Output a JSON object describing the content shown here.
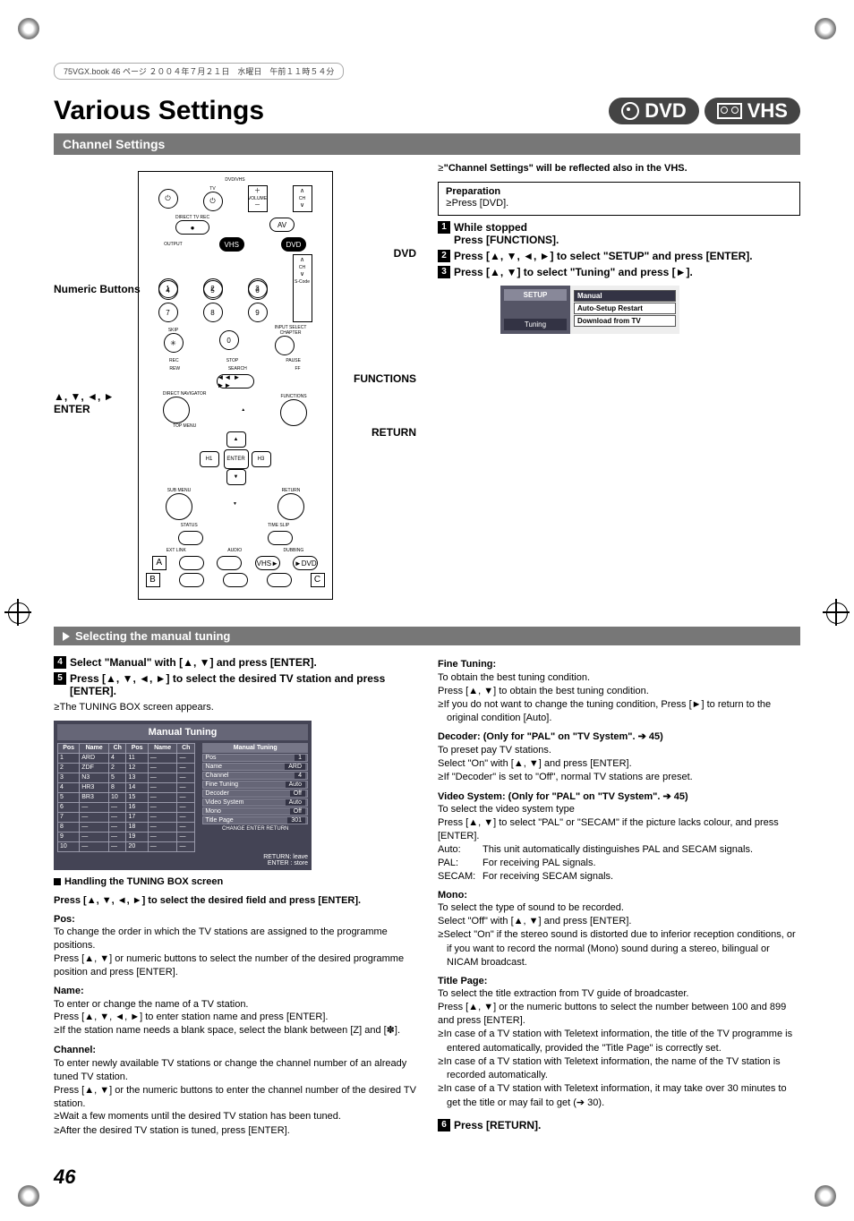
{
  "meta_header": "75VGX.book  46 ページ  ２００４年７月２１日　水曜日　午前１１時５４分",
  "title": "Various Settings",
  "badge_dvd": "DVD",
  "badge_vhs": "VHS",
  "section_channel_settings": "Channel Settings",
  "remote_callout": {
    "dvd": "DVD",
    "numeric": "Numeric Buttons",
    "functions": "FUNCTIONS",
    "arrows_enter": "▲, ▼, ◄, ►\nENTER",
    "return": "RETURN"
  },
  "remote_letters": {
    "a": "A",
    "b": "B",
    "c": "C"
  },
  "remote_btn_labels": {
    "dvd_vhs": "DVD/VHS",
    "tv": "TV",
    "volume": "VOLUME",
    "ch_label": "CH",
    "directrec": "DIRECT TV REC",
    "av": "AV",
    "output": "OUTPUT",
    "vhs": "VHS",
    "dvd": "DVD",
    "ch": "CH",
    "scode": "S-Code",
    "skip": "SKIP",
    "input": "INPUT SELECT",
    "chapter": "CHAPTER",
    "rec": "REC",
    "stop": "STOP",
    "pause": "PAUSE",
    "rew": "REW",
    "search": "SEARCH",
    "ff": "FF",
    "directnav": "DIRECT NAVIGATOR",
    "topmenu": "TOP MENU",
    "functions": "FUNCTIONS",
    "enter": "ENTER",
    "h1": "H1",
    "h3": "H3",
    "submenu": "SUB MENU",
    "return": "RETURN",
    "status": "STATUS",
    "timeslip": "TIME SLIP",
    "extlink": "EXT LINK",
    "audio": "AUDIO",
    "dubbing": "DUBBING",
    "vhs_to": "VHS►",
    "to_dvd": "►DVD"
  },
  "note_reflected": "\"Channel Settings\" will be reflected also in the VHS.",
  "preparation": {
    "title": "Preparation",
    "item": "Press [DVD]."
  },
  "steps_top": [
    {
      "n": "1",
      "bold_pre": "While stopped",
      "text": "Press [FUNCTIONS]."
    },
    {
      "n": "2",
      "text": "Press [▲, ▼, ◄, ►] to select \"SETUP\" and press [ENTER]."
    },
    {
      "n": "3",
      "text": "Press [▲, ▼] to select \"Tuning\" and press [►]."
    }
  ],
  "setup_panel": {
    "left_title": "SETUP",
    "left_selected": "Tuning",
    "options": [
      "Manual",
      "Auto-Setup Restart",
      "Download from TV"
    ],
    "selected": "Manual"
  },
  "sub_section": "Selecting the manual tuning",
  "steps_mid": [
    {
      "n": "4",
      "text": "Select \"Manual\" with [▲, ▼] and press [ENTER]."
    },
    {
      "n": "5",
      "text": "Press [▲, ▼, ◄, ►] to select the desired TV station and press [ENTER]."
    }
  ],
  "tuning_appears": "The TUNING BOX screen appears.",
  "manual_tuning": {
    "title": "Manual Tuning",
    "headers": [
      "Pos",
      "Name",
      "Ch"
    ],
    "rows_left": [
      {
        "pos": "1",
        "name": "ARD",
        "ch": "4"
      },
      {
        "pos": "2",
        "name": "ZDF",
        "ch": "2"
      },
      {
        "pos": "3",
        "name": "N3",
        "ch": "5"
      },
      {
        "pos": "4",
        "name": "HR3",
        "ch": "8"
      },
      {
        "pos": "5",
        "name": "BR3",
        "ch": "10"
      },
      {
        "pos": "6",
        "name": "",
        "ch": ""
      },
      {
        "pos": "7",
        "name": "",
        "ch": ""
      },
      {
        "pos": "8",
        "name": "",
        "ch": ""
      },
      {
        "pos": "9",
        "name": "",
        "ch": ""
      },
      {
        "pos": "10",
        "name": "",
        "ch": ""
      }
    ],
    "rows_right": [
      {
        "pos": "11",
        "name": "",
        "ch": ""
      },
      {
        "pos": "12",
        "name": "",
        "ch": ""
      },
      {
        "pos": "13",
        "name": "",
        "ch": ""
      },
      {
        "pos": "14",
        "name": "",
        "ch": ""
      },
      {
        "pos": "15",
        "name": "",
        "ch": ""
      },
      {
        "pos": "16",
        "name": "",
        "ch": ""
      },
      {
        "pos": "17",
        "name": "",
        "ch": ""
      },
      {
        "pos": "18",
        "name": "",
        "ch": ""
      },
      {
        "pos": "19",
        "name": "",
        "ch": ""
      },
      {
        "pos": "20",
        "name": "",
        "ch": ""
      }
    ],
    "side_title": "Manual Tuning",
    "side_nav_enter": "ENTER",
    "side_nav_return": "RETURN",
    "side_nav_change": "CHANGE",
    "side_kv": [
      {
        "k": "Pos",
        "v": "1"
      },
      {
        "k": "Name",
        "v": "ARD"
      },
      {
        "k": "Channel",
        "v": "4"
      },
      {
        "k": "Fine Tuning",
        "v": "Auto"
      },
      {
        "k": "Decoder",
        "v": "Off"
      },
      {
        "k": "Video System",
        "v": "Auto"
      },
      {
        "k": "Mono",
        "v": "Off"
      },
      {
        "k": "Title Page",
        "v": "301"
      }
    ],
    "foot_return": "RETURN:  leave",
    "foot_enter": "ENTER  :  store"
  },
  "handling_heading": "Handling the TUNING BOX screen",
  "handling_intro": "Press [▲, ▼, ◄, ►] to select the desired field and press [ENTER].",
  "pos_head": "Pos:",
  "pos_p1": "To change the order in which the TV stations are assigned to the programme positions.",
  "pos_p2": "Press [▲, ▼] or numeric buttons to select the number of the desired programme position and press [ENTER].",
  "name_head": "Name:",
  "name_p1": "To enter or change the name of a TV station.",
  "name_p2": "Press [▲, ▼, ◄, ►] to enter station name and press [ENTER].",
  "name_b1": "If the station name needs a blank space, select the blank between [Z] and [✽].",
  "channel_head": "Channel:",
  "channel_p1": "To enter newly available TV stations or change the channel number of an already tuned TV station.",
  "channel_p2": "Press [▲, ▼] or the numeric buttons to enter the channel number of the desired TV station.",
  "channel_b1": "Wait a few moments until the desired TV station has been tuned.",
  "channel_b2": "After the desired TV station is tuned, press [ENTER].",
  "fine_head": "Fine Tuning:",
  "fine_p1": "To obtain the best tuning condition.",
  "fine_p2": "Press [▲, ▼] to obtain the best tuning condition.",
  "fine_b1": "If you do not want to change the tuning condition, Press [►] to return to the original condition [Auto].",
  "decoder_head": "Decoder: (Only for \"PAL\" on \"TV System\". ➔ 45)",
  "decoder_p1": "To preset pay TV stations.",
  "decoder_p2": "Select \"On\" with [▲, ▼] and press [ENTER].",
  "decoder_b1": "If \"Decoder\" is set to \"Off\", normal TV stations are preset.",
  "video_head": "Video System: (Only for \"PAL\" on \"TV System\". ➔ 45)",
  "video_p1": "To select the video system type",
  "video_p2": "Press [▲, ▼] to select \"PAL\" or \"SECAM\" if the picture lacks colour, and press [ENTER].",
  "video_auto": "Auto:",
  "video_auto_t": "This unit automatically distinguishes PAL and SECAM signals.",
  "video_pal": "PAL:",
  "video_pal_t": "For receiving PAL signals.",
  "video_secam": "SECAM:",
  "video_secam_t": "For receiving SECAM signals.",
  "mono_head": "Mono:",
  "mono_p1": "To select the type of sound to be recorded.",
  "mono_p2": "Select \"Off\" with [▲, ▼] and press [ENTER].",
  "mono_b1": "Select \"On\" if the stereo sound is distorted due to inferior reception conditions, or if you want to record the normal (Mono) sound during a stereo, bilingual or NICAM broadcast.",
  "title_head": "Title Page:",
  "title_p1": "To select the title extraction from TV guide of broadcaster.",
  "title_p2": "Press [▲, ▼] or the numeric buttons to select the number between 100 and 899 and press [ENTER].",
  "title_b1": "In case of a TV station with Teletext information, the title of the TV programme is entered automatically, provided the \"Title Page\" is correctly set.",
  "title_b2": "In case of a TV station with Teletext information, the name of the TV station is recorded automatically.",
  "title_b3": "In case of a TV station with Teletext information, it may take over 30 minutes to get the title or may fail to get (➔ 30).",
  "step6": {
    "n": "6",
    "text": "Press [RETURN]."
  },
  "page_number": "46"
}
